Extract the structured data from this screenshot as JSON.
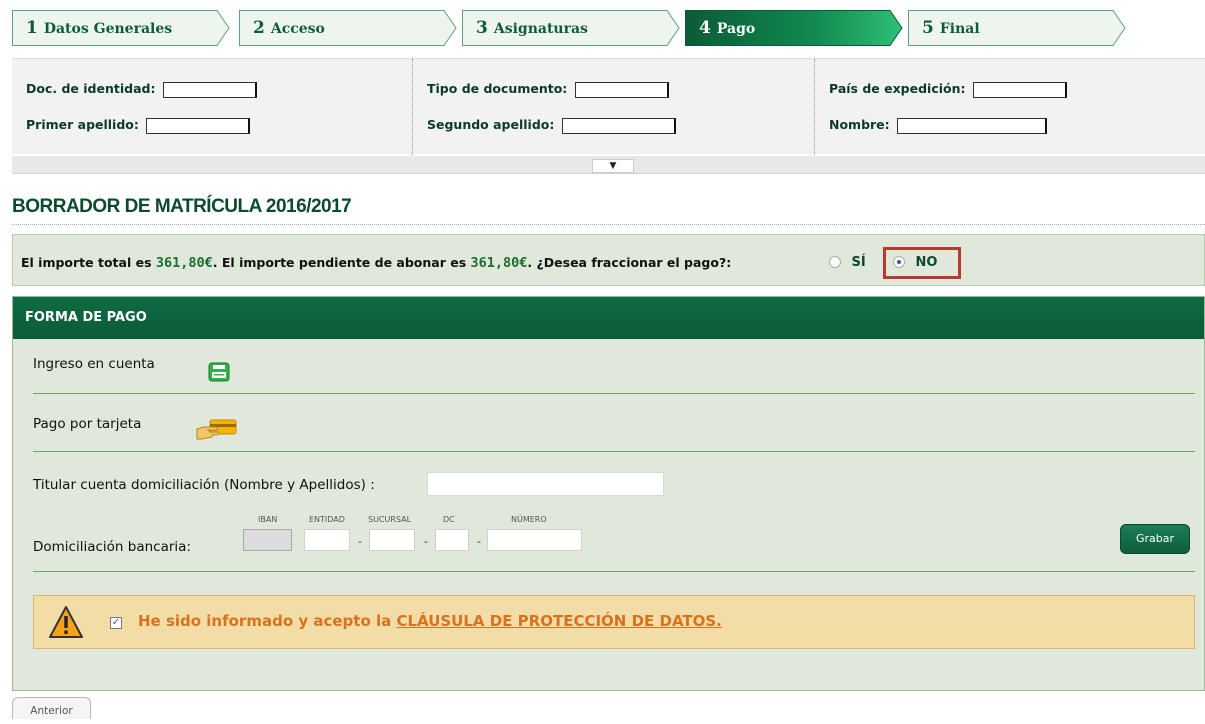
{
  "wizard": {
    "steps": [
      {
        "num": "1",
        "label": "Datos Generales"
      },
      {
        "num": "2",
        "label": "Acceso"
      },
      {
        "num": "3",
        "label": "Asignaturas"
      },
      {
        "num": "4",
        "label": "Pago"
      },
      {
        "num": "5",
        "label": "Final"
      }
    ],
    "active_step": "4"
  },
  "personal": {
    "doc_identidad_label": "Doc. de identidad:",
    "tipo_documento_label": "Tipo de documento:",
    "pais_expedicion_label": "País de expedición:",
    "primer_apellido_label": "Primer apellido:",
    "segundo_apellido_label": "Segundo apellido:",
    "nombre_label": "Nombre:",
    "collapse_glyph": "▼"
  },
  "title": "BORRADOR DE MATRÍCULA 2016/2017",
  "amount": {
    "prefix": "El importe total es",
    "total": "361,80€",
    "middle": ". El importe pendiente de abonar es",
    "pending": "361,80€",
    "question": ". ¿Desea fraccionar el pago?:",
    "option_si": "SÍ",
    "option_no": "NO",
    "selected": "NO"
  },
  "payment": {
    "header": "FORMA DE PAGO",
    "ingreso_label": "Ingreso en cuenta",
    "tarjeta_label": "Pago por tarjeta",
    "titular_label": "Titular cuenta domiciliación (Nombre y Apellidos) :",
    "titular_value": "",
    "domiciliacion_label": "Domiciliación bancaria:",
    "bank_fields": [
      "IBAN",
      "ENTIDAD",
      "SUCURSAL",
      "DC",
      "NÚMERO"
    ],
    "dash": "-",
    "grabar_label": "Grabar",
    "consent_checked": true,
    "consent_check_glyph": "✓",
    "consent_text": "He sido informado y acepto la",
    "consent_link": "CLÁUSULA DE PROTECCIÓN DE DATOS."
  },
  "nav": {
    "anterior_label": "Anterior"
  },
  "colors": {
    "primary_green": "#0d5c38",
    "panel_bg": "#dfe8db",
    "money_green": "#1b6e2e",
    "highlight_red": "#b8392e",
    "consent_bg": "#f3dda7",
    "consent_text": "#d9711e"
  }
}
